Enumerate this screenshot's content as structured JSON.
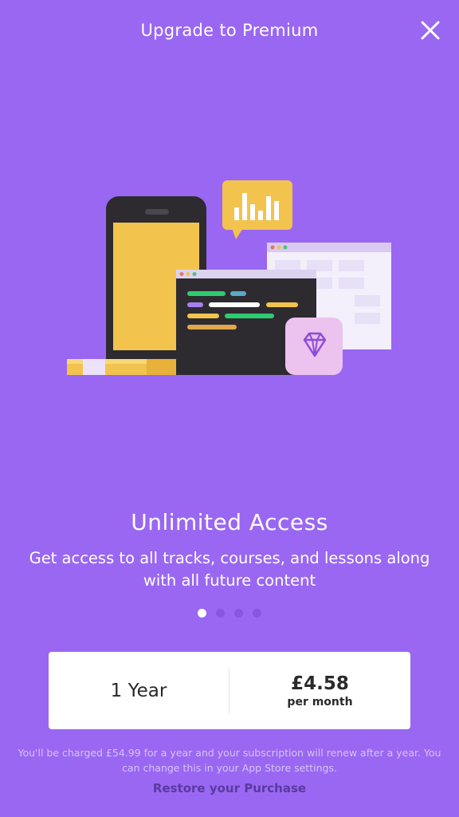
{
  "header": {
    "title": "Upgrade to Premium",
    "close_icon": "close-icon"
  },
  "illustration": {
    "icons": [
      "phone-illustration",
      "bar-chart-speech-bubble-icon",
      "code-editor-window",
      "browser-window",
      "diamond-badge-icon",
      "pencil-illustration"
    ]
  },
  "feature": {
    "headline": "Unlimited Access",
    "description": "Get access to all tracks, courses, and lessons along with all future content"
  },
  "pagination": {
    "total": 4,
    "active_index": 0
  },
  "plan": {
    "period": "1 Year",
    "price": "£4.58",
    "price_unit": "per month"
  },
  "legal": {
    "disclaimer": "You'll be charged £54.99 for a year and your subscription will renew after a year. You can change this in your App Store settings.",
    "restore_label": "Restore your Purchase"
  },
  "colors": {
    "background": "#9a67f2",
    "accent_yellow": "#f2c34d",
    "dark": "#2d2b30",
    "restore_link": "#5a3aa0"
  }
}
